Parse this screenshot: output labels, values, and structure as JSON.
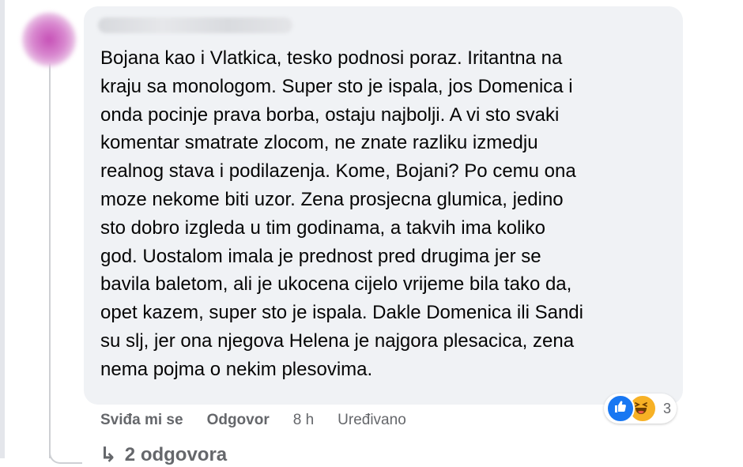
{
  "comment": {
    "author_name": "",
    "text_lines": [
      "Bojana kao i Vlatkica, tesko podnosi poraz. Iritantna na",
      "kraju sa monologom. Super sto je ispala, jos Domenica i",
      "onda pocinje prava borba, ostaju najbolji. A vi sto svaki",
      "komentar smatrate zlocom, ne znate razliku izmedju",
      "realnog stava i podilazenja. Kome, Bojani? Po cemu ona",
      "moze nekome biti uzor. Zena prosjecna glumica, jedino",
      "sto dobro izgleda u tim godinama, a takvih ima koliko",
      "god. Uostalom imala je prednost pred drugima jer se",
      "bavila baletom, ali je ukocena cijelo vrijeme bila tako da,",
      "opet kazem, super sto je ispala. Dakle Domenica ili Sandi",
      "su slj, jer ona njegova Helena je najgora plesacica, zena",
      "nema pojma o nekim plesovima."
    ],
    "actions": {
      "like_label": "Sviđa mi se",
      "reply_label": "Odgovor",
      "timestamp": "8 h",
      "edited_label": "Uređivano"
    },
    "reactions": {
      "icons": [
        "like-icon",
        "haha-icon"
      ],
      "count": "3"
    },
    "replies_label": "2 odgovora"
  },
  "colors": {
    "bubble_bg": "#f0f2f5",
    "secondary_text": "#65676b",
    "like_blue": "#1877f2",
    "haha_yellow": "#f7b125"
  }
}
